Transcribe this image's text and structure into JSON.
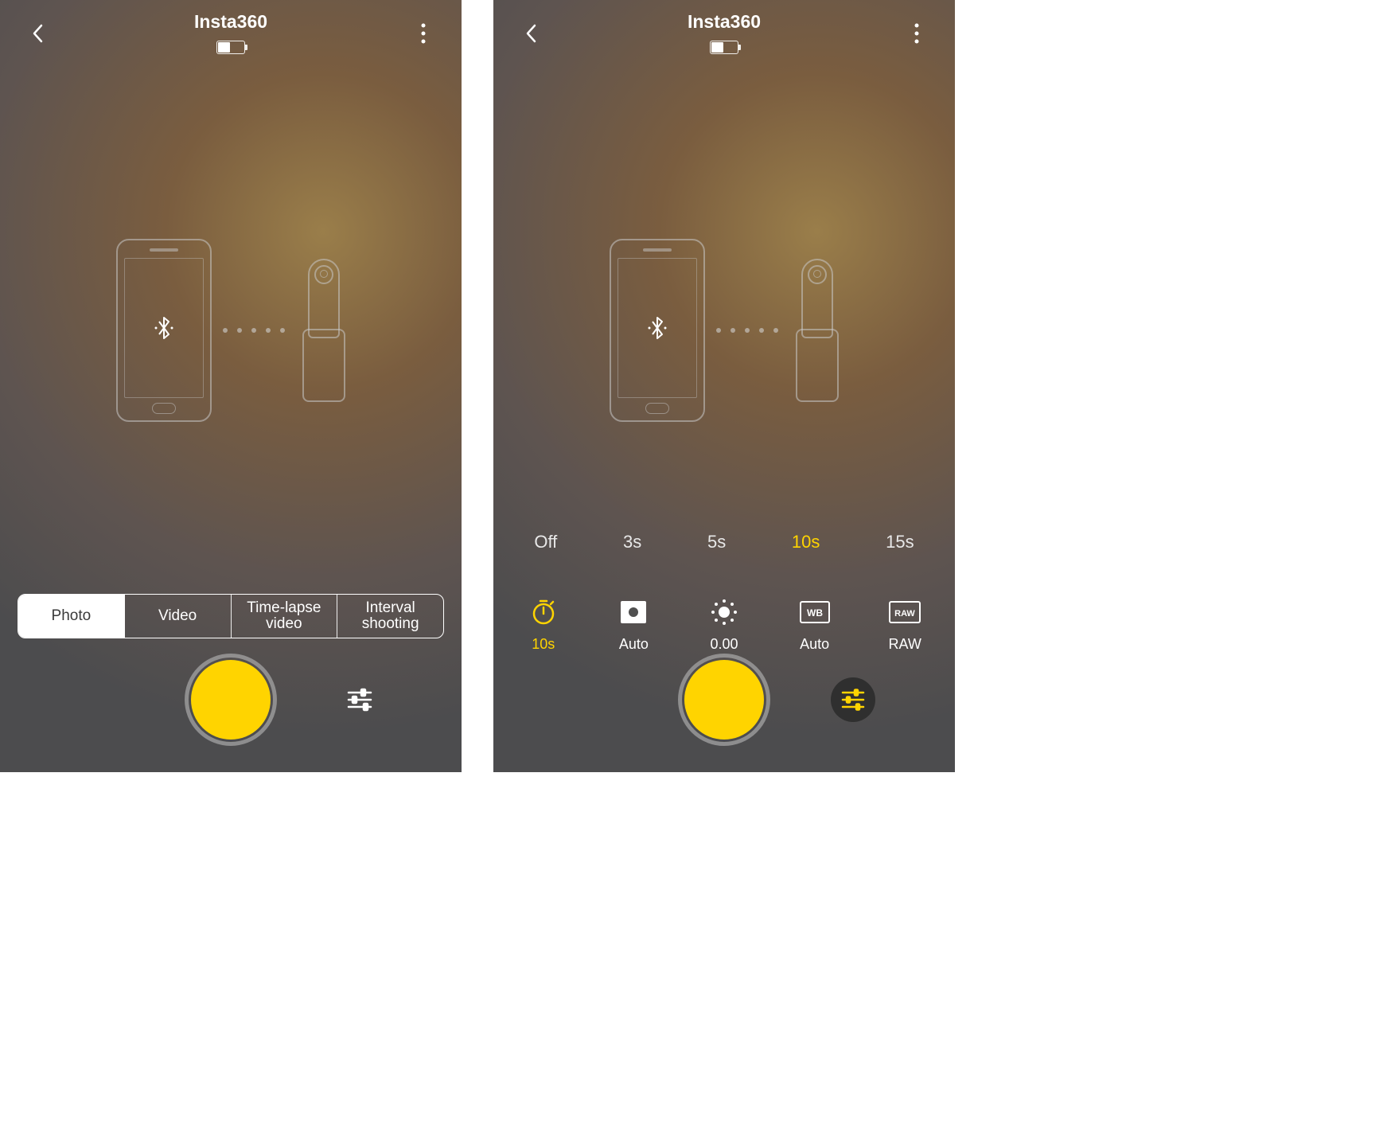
{
  "colors": {
    "accent": "#ffd400",
    "text_light": "#ffffff",
    "text_dim": "#e0e0e0"
  },
  "screenA": {
    "header": {
      "title": "Insta360",
      "battery_pct": 45
    },
    "modes": [
      {
        "label": "Photo",
        "active": true
      },
      {
        "label": "Video",
        "active": false
      },
      {
        "label": "Time-lapse video",
        "active": false
      },
      {
        "label": "Interval shooting",
        "active": false
      }
    ]
  },
  "screenB": {
    "header": {
      "title": "Insta360",
      "battery_pct": 45
    },
    "timer_options": [
      {
        "label": "Off",
        "active": false
      },
      {
        "label": "3s",
        "active": false
      },
      {
        "label": "5s",
        "active": false
      },
      {
        "label": "10s",
        "active": true
      },
      {
        "label": "15s",
        "active": false
      }
    ],
    "params": [
      {
        "name": "timer",
        "label": "10s",
        "active": true
      },
      {
        "name": "metering",
        "label": "Auto",
        "active": false
      },
      {
        "name": "exposure",
        "label": "0.00",
        "active": false
      },
      {
        "name": "white_balance",
        "label": "Auto",
        "active": false
      },
      {
        "name": "format",
        "label": "RAW",
        "active": false
      }
    ]
  }
}
